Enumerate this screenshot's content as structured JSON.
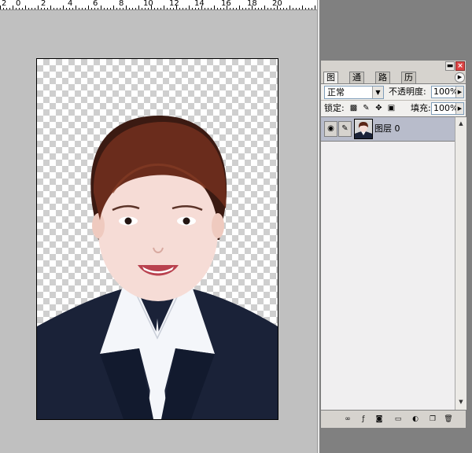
{
  "ruler": {
    "numbers": [
      "2",
      "0",
      "2",
      "4",
      "6",
      "8",
      "10",
      "12",
      "14",
      "16",
      "18",
      "20"
    ]
  },
  "palette": {
    "tabs": [
      "图层",
      "通道",
      "路径",
      "历史记录"
    ],
    "blend_mode": "正常",
    "opacity_label": "不透明度:",
    "opacity_value": "100%",
    "lock_label": "锁定:",
    "fill_label": "填充:",
    "fill_value": "100%",
    "layer": {
      "name": "图层 0"
    },
    "close_glyph": "×"
  },
  "colors": {
    "workspace": "#c0c0c0",
    "layer_selected": "#b8bccb",
    "hair": "#3b1a12",
    "suit": "#1a2238",
    "shirt": "#f4f6fa"
  },
  "icons": [
    "minimize-icon",
    "close-icon",
    "menu-arrow-icon",
    "eye-icon",
    "brush-icon",
    "lock-transparency-icon",
    "lock-paint-icon",
    "lock-move-icon",
    "lock-all-icon",
    "link-layers-icon",
    "layer-style-icon",
    "layer-mask-icon",
    "new-group-icon",
    "adjustment-layer-icon",
    "new-layer-icon",
    "trash-icon"
  ]
}
